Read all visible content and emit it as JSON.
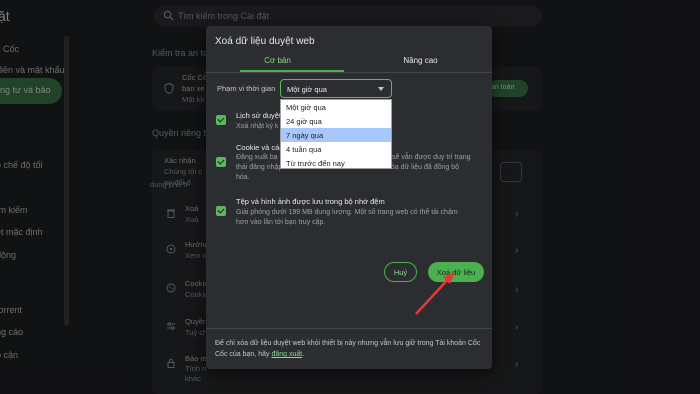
{
  "search": {
    "placeholder": "Tìm kiếm trong Cài đặt"
  },
  "sidebar": {
    "title": "ặt",
    "items": [
      {
        "label": "c Cốc"
      },
      {
        "label": "điền và mật khẩu"
      },
      {
        "label": "ng tư và bảo"
      },
      {
        "label": "o chế độ tối"
      },
      {
        "label": "ìm kiếm"
      },
      {
        "label": "ệt mặc định"
      },
      {
        "label": "động"
      },
      {
        "label": "torrent"
      },
      {
        "label": "ng cáo"
      },
      {
        "label": "p cận"
      }
    ]
  },
  "background": {
    "safety_section": "Kiểm tra an to",
    "safety_card": {
      "line1": "Cốc Cố",
      "line2": "bạn xe",
      "line3": "Mật kh",
      "button": "an toàn"
    },
    "privacy_section": "Quyền riêng tư",
    "privacy_card": {
      "line1": "Xác nhận",
      "line2": "Chúng tôi c",
      "line3": "ao đổi d",
      "line4": "dung phù h"
    },
    "rows": [
      {
        "title": "Xoá",
        "desc": "Xoá"
      },
      {
        "title": "Hướng",
        "desc": "Xem x"
      },
      {
        "title": "Cookie",
        "desc": "Cookie"
      },
      {
        "title": "Quyền",
        "desc": "Tuỳ ch"
      },
      {
        "title": "Bảo m",
        "desc": "Tính n",
        "desc2": "khác"
      }
    ]
  },
  "dialog": {
    "title": "Xoá dữ liệu duyệt web",
    "tabs": [
      {
        "label": "Cơ bản"
      },
      {
        "label": "Nâng cao"
      }
    ],
    "time_range_label": "Phạm vi thời gian",
    "time_range_selected": "Một giờ qua",
    "time_range_options": [
      {
        "label": "Một giờ qua"
      },
      {
        "label": "24 giờ qua"
      },
      {
        "label": "7 ngày qua"
      },
      {
        "label": "4 tuần qua"
      },
      {
        "label": "Từ trước đến nay"
      }
    ],
    "items": [
      {
        "title": "Lịch sử duyệt",
        "desc": "Xoá nhật ký k",
        "checked": true
      },
      {
        "title": "Cookie và các",
        "desc_a": "Đăng xuất bạ",
        "desc_a2": "sẽ vẫn được duy trì trạng",
        "desc_b": "thái đăng nhập vào tài khoản Cốc Cốc để có thể xóa dữ liệu đã đồng bộ",
        "desc_c": "hóa.",
        "checked": true
      },
      {
        "title": "Tệp và hình ảnh được lưu trong bộ nhớ đệm",
        "desc_a": "Giải phóng dưới 199 MB dung lượng. Một số trang web có thể tải chậm",
        "desc_b": "hơn vào lần tới bạn truy cập.",
        "checked": true
      }
    ],
    "cancel_label": "Huỷ",
    "clear_label": "Xoá dữ liệu",
    "footer_text": "Để chỉ xóa dữ liệu duyệt web khỏi thiết bị này nhưng vẫn lưu giữ trong Tài khoản Cốc Cốc của bạn, hãy",
    "footer_link": "đăng xuất",
    "footer_end": "."
  },
  "colors": {
    "accent": "#4caf50",
    "dialog_bg": "#2c2d30",
    "page_bg": "#202124",
    "annotation_arrow": "#e53935"
  }
}
